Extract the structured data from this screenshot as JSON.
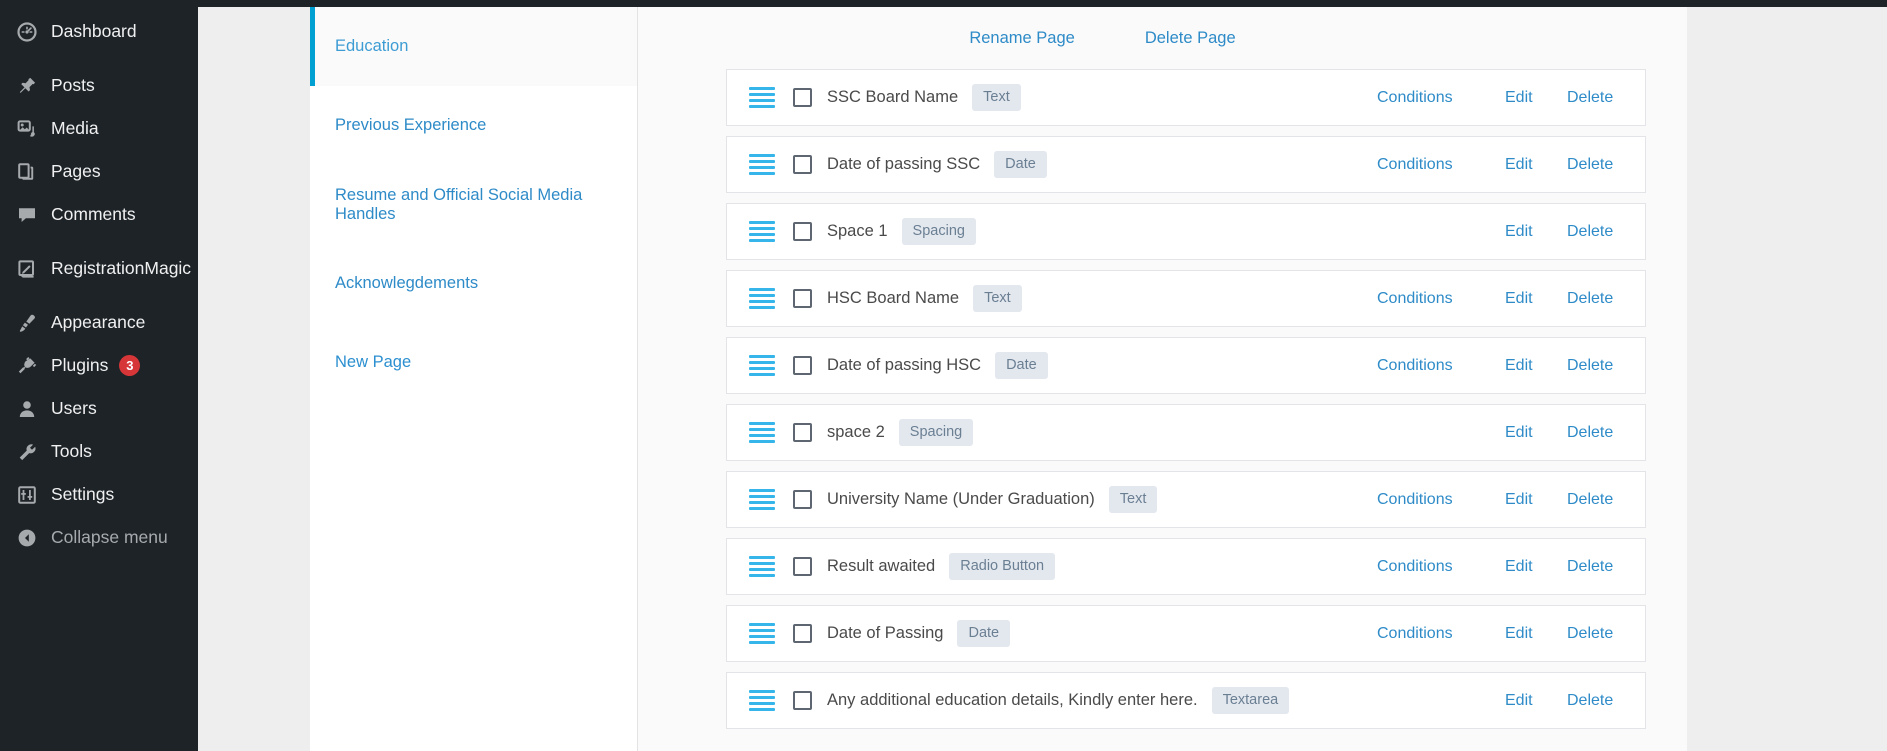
{
  "admin_sidebar": {
    "items": [
      {
        "label": "Dashboard",
        "icon": "dashboard-icon",
        "badge": null
      },
      {
        "label": "Posts",
        "icon": "pin-icon",
        "badge": null
      },
      {
        "label": "Media",
        "icon": "media-icon",
        "badge": null
      },
      {
        "label": "Pages",
        "icon": "pages-icon",
        "badge": null
      },
      {
        "label": "Comments",
        "icon": "comment-icon",
        "badge": null
      },
      {
        "label": "RegistrationMagic",
        "icon": "registrationmagic-icon",
        "badge": null
      },
      {
        "label": "Appearance",
        "icon": "brush-icon",
        "badge": null
      },
      {
        "label": "Plugins",
        "icon": "plug-icon",
        "badge": "3"
      },
      {
        "label": "Users",
        "icon": "user-icon",
        "badge": null
      },
      {
        "label": "Tools",
        "icon": "wrench-icon",
        "badge": null
      },
      {
        "label": "Settings",
        "icon": "settings-icon",
        "badge": null
      },
      {
        "label": "Collapse menu",
        "icon": "collapse-icon",
        "badge": null
      }
    ],
    "badge_color": "#d63638",
    "background_color": "#1d2327"
  },
  "pages_panel": {
    "accent_color": "#00a0d2",
    "items": [
      {
        "label": "Education",
        "active": true
      },
      {
        "label": "Previous Experience",
        "active": false
      },
      {
        "label": "Resume and Official Social Media Handles",
        "active": false
      },
      {
        "label": "Acknowlegdements",
        "active": false
      },
      {
        "label": "New Page",
        "active": false
      }
    ]
  },
  "toolbar": {
    "rename_page_label": "Rename Page",
    "delete_page_label": "Delete Page"
  },
  "actions": {
    "conditions_label": "Conditions",
    "edit_label": "Edit",
    "delete_label": "Delete"
  },
  "fields": [
    {
      "label": "SSC Board Name",
      "type": "Text",
      "has_conditions": true
    },
    {
      "label": "Date of passing SSC",
      "type": "Date",
      "has_conditions": true
    },
    {
      "label": "Space 1",
      "type": "Spacing",
      "has_conditions": false
    },
    {
      "label": "HSC Board Name",
      "type": "Text",
      "has_conditions": true
    },
    {
      "label": "Date of passing HSC",
      "type": "Date",
      "has_conditions": true
    },
    {
      "label": "space 2",
      "type": "Spacing",
      "has_conditions": false
    },
    {
      "label": "University Name (Under Graduation)",
      "type": "Text",
      "has_conditions": true
    },
    {
      "label": "Result awaited",
      "type": "Radio Button",
      "has_conditions": true
    },
    {
      "label": "Date of Passing",
      "type": "Date",
      "has_conditions": true
    },
    {
      "label": "Any additional education details, Kindly enter here.",
      "type": "Textarea",
      "has_conditions": false
    }
  ]
}
